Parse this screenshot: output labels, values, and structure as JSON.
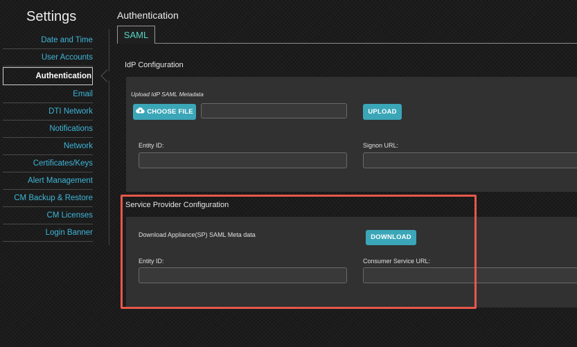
{
  "sidebar": {
    "title": "Settings",
    "items": [
      {
        "label": "Date and Time"
      },
      {
        "label": "User Accounts"
      },
      {
        "label": "Authentication"
      },
      {
        "label": "Email"
      },
      {
        "label": "DTI Network"
      },
      {
        "label": "Notifications"
      },
      {
        "label": "Network"
      },
      {
        "label": "Certificates/Keys"
      },
      {
        "label": "Alert Management"
      },
      {
        "label": "CM Backup & Restore"
      },
      {
        "label": "CM Licenses"
      },
      {
        "label": "Login Banner"
      }
    ],
    "active_index": 2
  },
  "header": {
    "title": "Authentication"
  },
  "tabs": [
    {
      "label": "SAML"
    }
  ],
  "idp": {
    "heading": "IdP Configuration",
    "upload_label": "Upload IdP SAML Metadata",
    "choose_file_label": "CHOOSE FILE",
    "upload_button_label": "UPLOAD",
    "entity_id_label": "Entity ID:",
    "entity_id_value": "",
    "signon_url_label": "Signon URL:",
    "signon_url_value": ""
  },
  "sp": {
    "heading": "Service Provider Configuration",
    "download_text": "Download Appliance(SP) SAML Meta data",
    "download_button_label": "DOWNLOAD",
    "entity_id_label": "Entity ID:",
    "entity_id_value": "",
    "consumer_url_label": "Consumer Service URL:",
    "consumer_url_value": ""
  },
  "colors": {
    "accent_link": "#3fb6d8",
    "tab_text": "#56d6c5",
    "button": "#3ba6b8",
    "highlight": "#e8584a"
  },
  "icons": {
    "choose_file": "cloud-upload-icon"
  }
}
